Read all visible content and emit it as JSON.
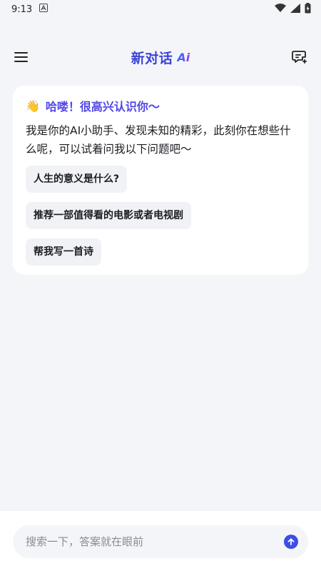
{
  "status_bar": {
    "time": "9:13",
    "icons": [
      "accessibility-icon",
      "wifi-icon",
      "signal-icon",
      "battery-charging-icon"
    ]
  },
  "header": {
    "title": "新对话",
    "logo_text": "Ai",
    "left_icon": "menu-icon",
    "right_icon": "new-chat-icon"
  },
  "welcome": {
    "emoji": "👋",
    "greeting": "哈喽！很高兴认识你～",
    "intro": "我是你的AI小助手、发现未知的精彩，此刻你在想些什么呢，可以试着问我以下问题吧～",
    "suggestions": [
      "人生的意义是什么?",
      "推荐一部值得看的电影或者电视剧",
      "帮我写一首诗"
    ]
  },
  "search": {
    "placeholder": "搜索一下，答案就在眼前",
    "send_icon": "send-arrow-icon"
  },
  "colors": {
    "accent": "#3b43d6",
    "greeting": "#5146e6",
    "send": "#3d4ee6",
    "background": "#f4f5f9"
  }
}
